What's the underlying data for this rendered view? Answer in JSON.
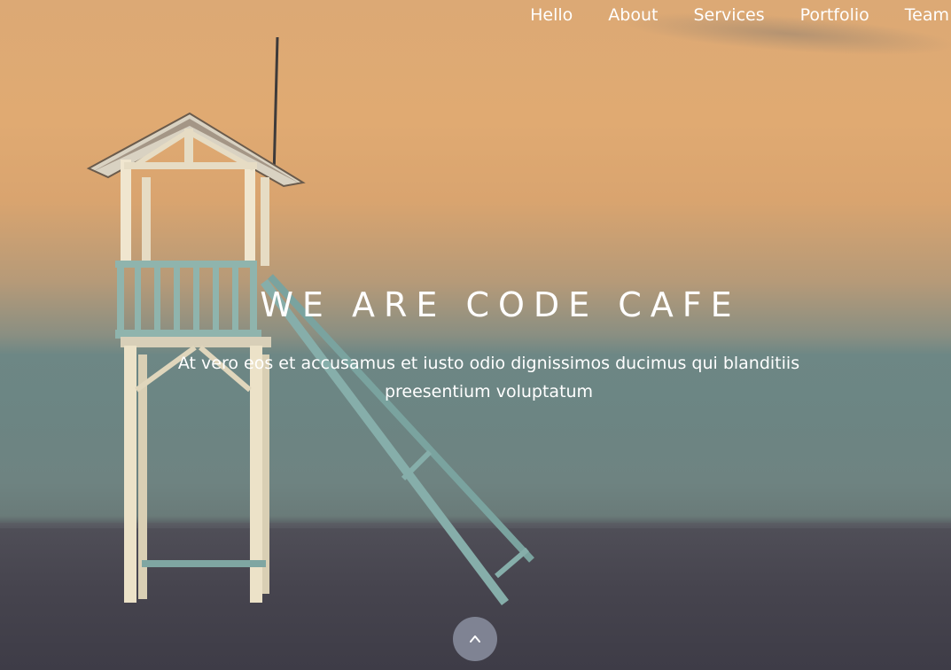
{
  "nav": {
    "items": [
      {
        "label": "Hello"
      },
      {
        "label": "About"
      },
      {
        "label": "Services"
      },
      {
        "label": "Portfolio"
      },
      {
        "label": "Team"
      }
    ]
  },
  "hero": {
    "title": "WE ARE CODE CAFE",
    "subtitle": "At vero eos et accusamus et iusto odio dignissimos ducimus qui blanditiis preesentium voluptatum"
  },
  "scroll_button": {
    "icon": "chevron-up-icon"
  }
}
